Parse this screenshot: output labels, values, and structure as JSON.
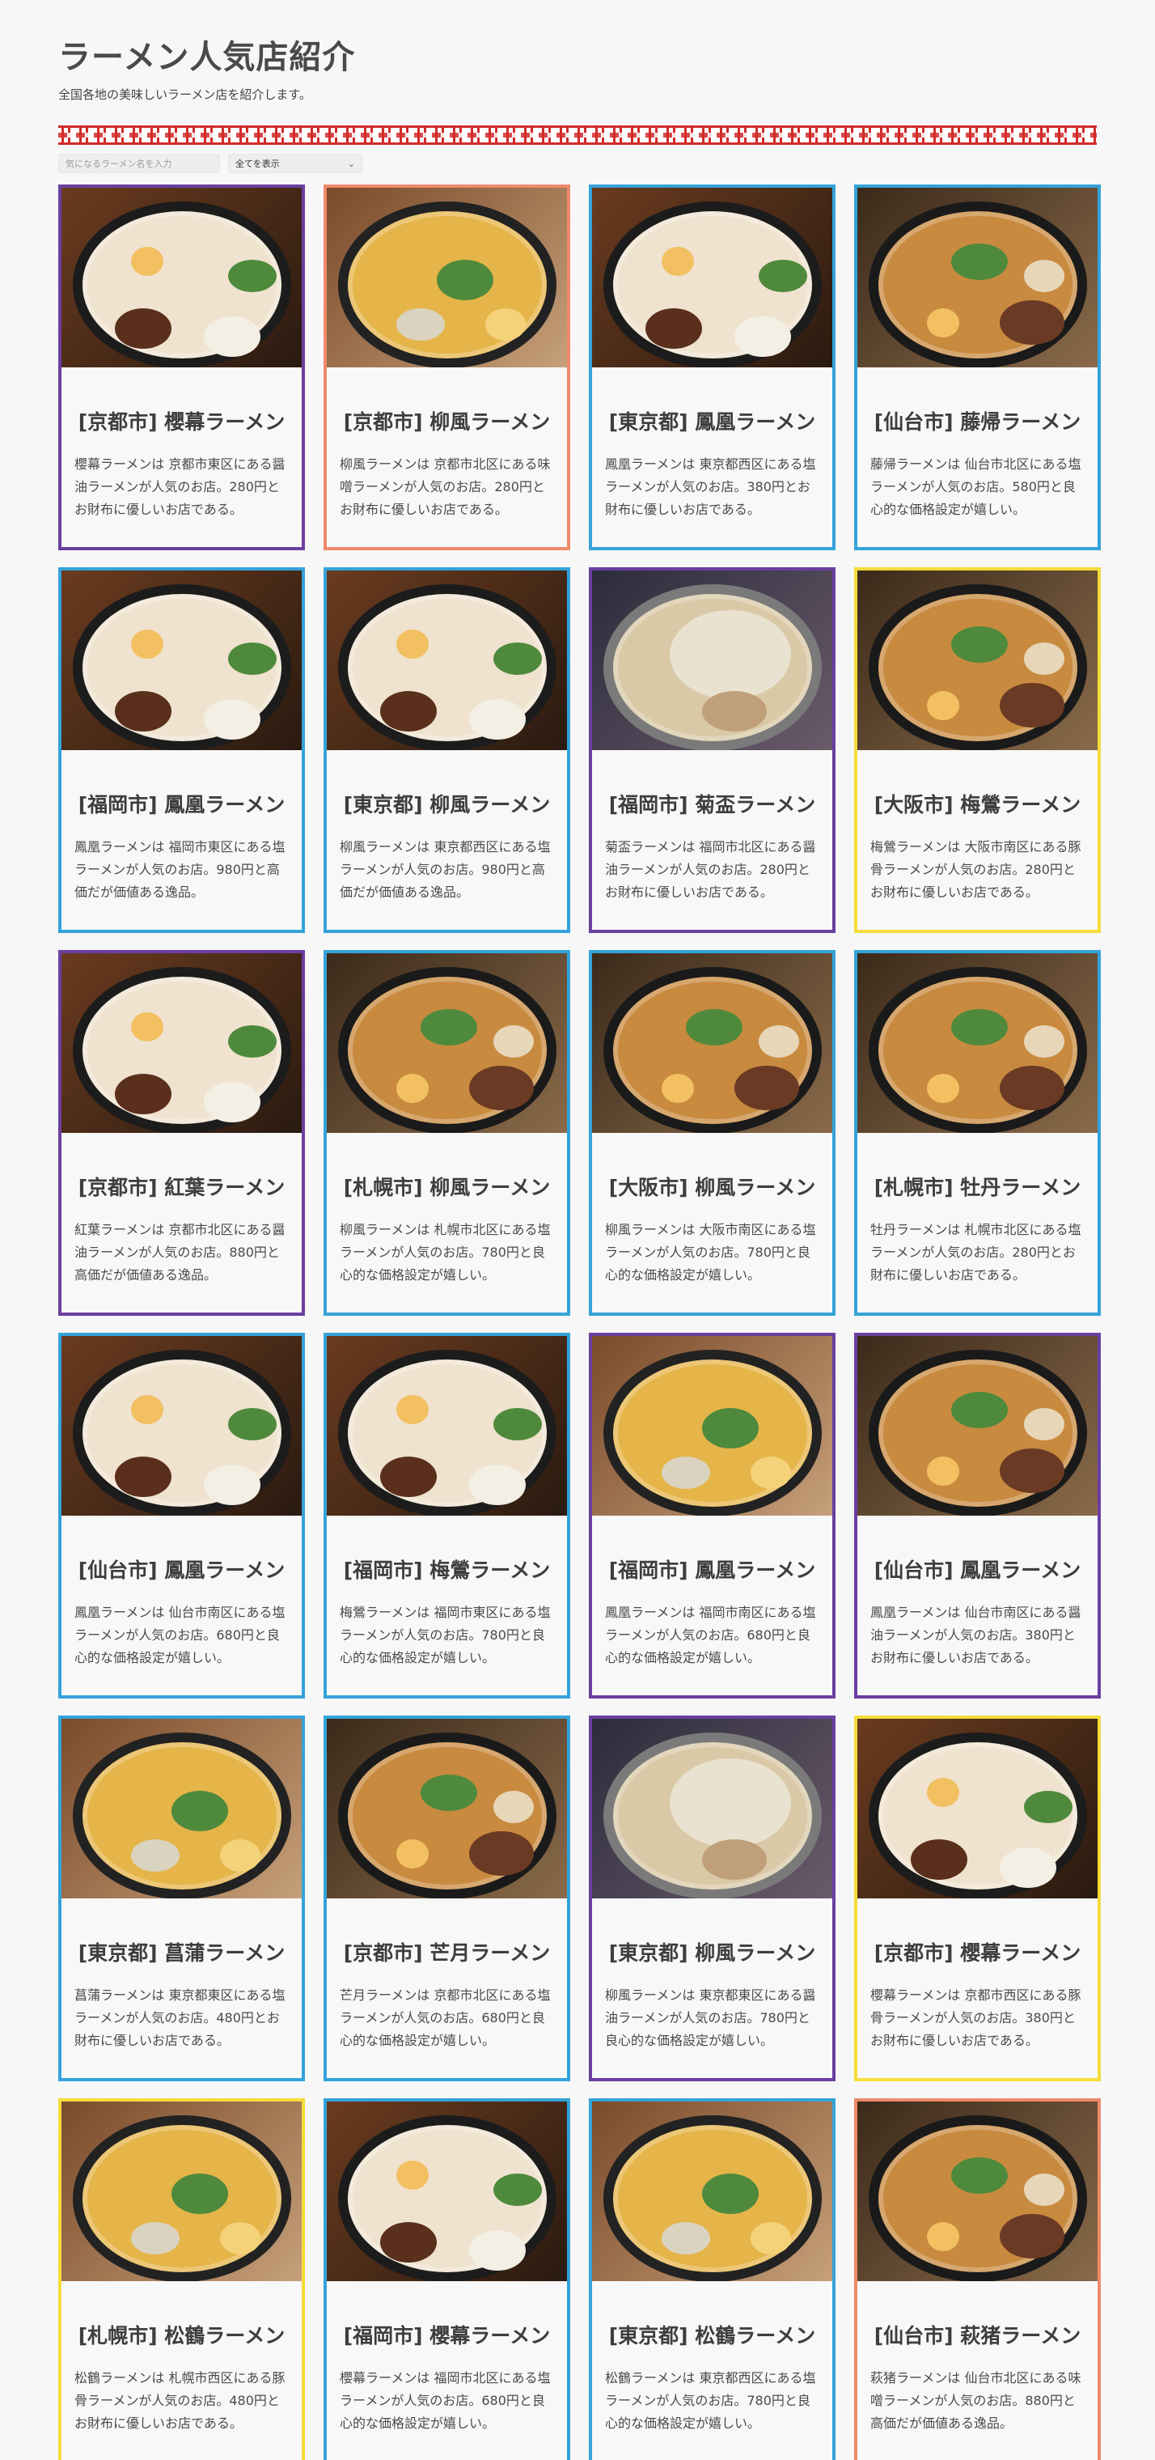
{
  "header": {
    "title": "ラーメン人気店紹介",
    "subtitle": "全国各地の美味しいラーメン店を紹介します。"
  },
  "controls": {
    "search_placeholder": "気になるラーメン名を入力",
    "filter_selected": "全てを表示"
  },
  "colors": {
    "blue": "#34a3d9",
    "purple": "#6b3fa0",
    "orange": "#ee8a6a",
    "yellow": "#f6dc3a",
    "accent_red": "#d22a2a"
  },
  "cards": [
    {
      "title": "[京都市] 櫻幕ラーメン",
      "desc": "櫻幕ラーメンは 京都市東区にある醤油ラーメンが人気のお店。280円とお財布に優しいお店である。",
      "border": "purple",
      "photo": "tonkotsu-bowl"
    },
    {
      "title": "[京都市] 柳風ラーメン",
      "desc": "柳風ラーメンは 京都市北区にある味噌ラーメンが人気のお店。280円とお財布に優しいお店である。",
      "border": "orange",
      "photo": "miso-bowl"
    },
    {
      "title": "[東京都] 鳳凰ラーメン",
      "desc": "鳳凰ラーメンは 東京都西区にある塩ラーメンが人気のお店。380円とお財布に優しいお店である。",
      "border": "blue",
      "photo": "tonkotsu-bowl"
    },
    {
      "title": "[仙台市] 藤帰ラーメン",
      "desc": "藤帰ラーメンは 仙台市北区にある塩ラーメンが人気のお店。580円と良心的な価格設定が嬉しい。",
      "border": "blue",
      "photo": "shoyu-bowl"
    },
    {
      "title": "[福岡市] 鳳凰ラーメン",
      "desc": "鳳凰ラーメンは 福岡市東区にある塩ラーメンが人気のお店。980円と高価だが価値ある逸品。",
      "border": "blue",
      "photo": "tonkotsu-bowl"
    },
    {
      "title": "[東京都] 柳風ラーメン",
      "desc": "柳風ラーメンは 東京都西区にある塩ラーメンが人気のお店。980円と高価だが価値ある逸品。",
      "border": "blue",
      "photo": "tonkotsu-bowl"
    },
    {
      "title": "[福岡市] 菊盃ラーメン",
      "desc": "菊盃ラーメンは 福岡市北区にある醤油ラーメンが人気のお店。280円とお財布に優しいお店である。",
      "border": "purple",
      "photo": "jiro-bowl"
    },
    {
      "title": "[大阪市] 梅鶯ラーメン",
      "desc": "梅鶯ラーメンは 大阪市南区にある豚骨ラーメンが人気のお店。280円とお財布に優しいお店である。",
      "border": "yellow",
      "photo": "shoyu-bowl"
    },
    {
      "title": "[京都市] 紅葉ラーメン",
      "desc": "紅葉ラーメンは 京都市北区にある醤油ラーメンが人気のお店。880円と高価だが価値ある逸品。",
      "border": "purple",
      "photo": "tonkotsu-bowl"
    },
    {
      "title": "[札幌市] 柳風ラーメン",
      "desc": "柳風ラーメンは 札幌市北区にある塩ラーメンが人気のお店。780円と良心的な価格設定が嬉しい。",
      "border": "blue",
      "photo": "shoyu-bowl"
    },
    {
      "title": "[大阪市] 柳風ラーメン",
      "desc": "柳風ラーメンは 大阪市南区にある塩ラーメンが人気のお店。780円と良心的な価格設定が嬉しい。",
      "border": "blue",
      "photo": "shoyu-bowl"
    },
    {
      "title": "[札幌市] 牡丹ラーメン",
      "desc": "牡丹ラーメンは 札幌市北区にある塩ラーメンが人気のお店。280円とお財布に優しいお店である。",
      "border": "blue",
      "photo": "shoyu-bowl"
    },
    {
      "title": "[仙台市] 鳳凰ラーメン",
      "desc": "鳳凰ラーメンは 仙台市南区にある塩ラーメンが人気のお店。680円と良心的な価格設定が嬉しい。",
      "border": "blue",
      "photo": "tonkotsu-bowl"
    },
    {
      "title": "[福岡市] 梅鶯ラーメン",
      "desc": "梅鶯ラーメンは 福岡市東区にある塩ラーメンが人気のお店。780円と良心的な価格設定が嬉しい。",
      "border": "blue",
      "photo": "tonkotsu-bowl"
    },
    {
      "title": "[福岡市] 鳳凰ラーメン",
      "desc": "鳳凰ラーメンは 福岡市南区にある塩ラーメンが人気のお店。680円と良心的な価格設定が嬉しい。",
      "border": "purple",
      "photo": "miso-bowl"
    },
    {
      "title": "[仙台市] 鳳凰ラーメン",
      "desc": "鳳凰ラーメンは 仙台市南区にある醤油ラーメンが人気のお店。380円とお財布に優しいお店である。",
      "border": "purple",
      "photo": "shoyu-bowl"
    },
    {
      "title": "[東京都] 菖蒲ラーメン",
      "desc": "菖蒲ラーメンは 東京都東区にある塩ラーメンが人気のお店。480円とお財布に優しいお店である。",
      "border": "blue",
      "photo": "miso-bowl"
    },
    {
      "title": "[京都市] 芒月ラーメン",
      "desc": "芒月ラーメンは 京都市北区にある塩ラーメンが人気のお店。680円と良心的な価格設定が嬉しい。",
      "border": "blue",
      "photo": "shoyu-bowl"
    },
    {
      "title": "[東京都] 柳風ラーメン",
      "desc": "柳風ラーメンは 東京都東区にある醤油ラーメンが人気のお店。780円と良心的な価格設定が嬉しい。",
      "border": "purple",
      "photo": "jiro-bowl"
    },
    {
      "title": "[京都市] 櫻幕ラーメン",
      "desc": "櫻幕ラーメンは 京都市西区にある豚骨ラーメンが人気のお店。380円とお財布に優しいお店である。",
      "border": "yellow",
      "photo": "tonkotsu-bowl"
    },
    {
      "title": "[札幌市] 松鶴ラーメン",
      "desc": "松鶴ラーメンは 札幌市西区にある豚骨ラーメンが人気のお店。480円とお財布に優しいお店である。",
      "border": "yellow",
      "photo": "miso-bowl"
    },
    {
      "title": "[福岡市] 櫻幕ラーメン",
      "desc": "櫻幕ラーメンは 福岡市北区にある塩ラーメンが人気のお店。680円と良心的な価格設定が嬉しい。",
      "border": "blue",
      "photo": "tonkotsu-bowl"
    },
    {
      "title": "[東京都] 松鶴ラーメン",
      "desc": "松鶴ラーメンは 東京都西区にある塩ラーメンが人気のお店。780円と良心的な価格設定が嬉しい。",
      "border": "blue",
      "photo": "miso-bowl"
    },
    {
      "title": "[仙台市] 萩猪ラーメン",
      "desc": "萩猪ラーメンは 仙台市北区にある味噌ラーメンが人気のお店。880円と高価だが価値ある逸品。",
      "border": "orange",
      "photo": "shoyu-bowl"
    }
  ]
}
